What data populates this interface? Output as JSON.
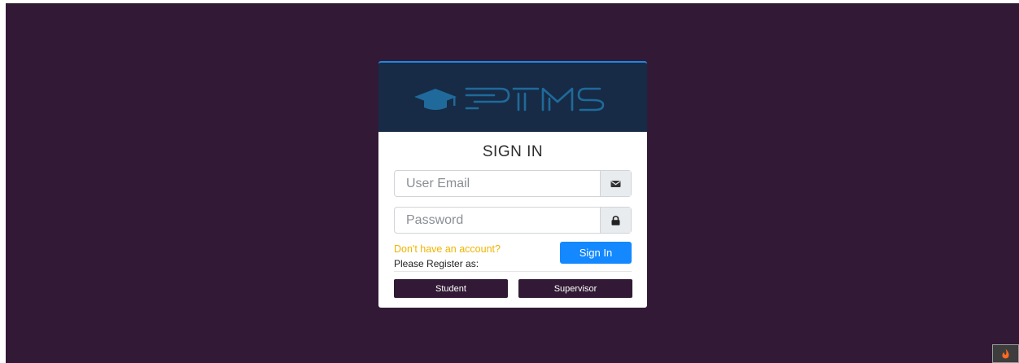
{
  "app": {
    "logo_text": "PTMS",
    "colors": {
      "background": "#321a36",
      "header": "#172b46",
      "logo": "#1f6a9a",
      "accent": "#1e88e5",
      "primary_button": "#1388ff",
      "link": "#f0b400",
      "role_button": "#321a36"
    }
  },
  "signin": {
    "title": "SIGN IN",
    "email_placeholder": "User Email",
    "email_icon": "envelope-icon",
    "password_placeholder": "Password",
    "password_icon": "lock-icon",
    "signup_prompt": "Don't have an account?",
    "register_label": "Please Register as:",
    "signin_button": "Sign In",
    "student_button": "Student",
    "supervisor_button": "Supervisor"
  },
  "corner_widget": {
    "icon": "flame-icon"
  }
}
